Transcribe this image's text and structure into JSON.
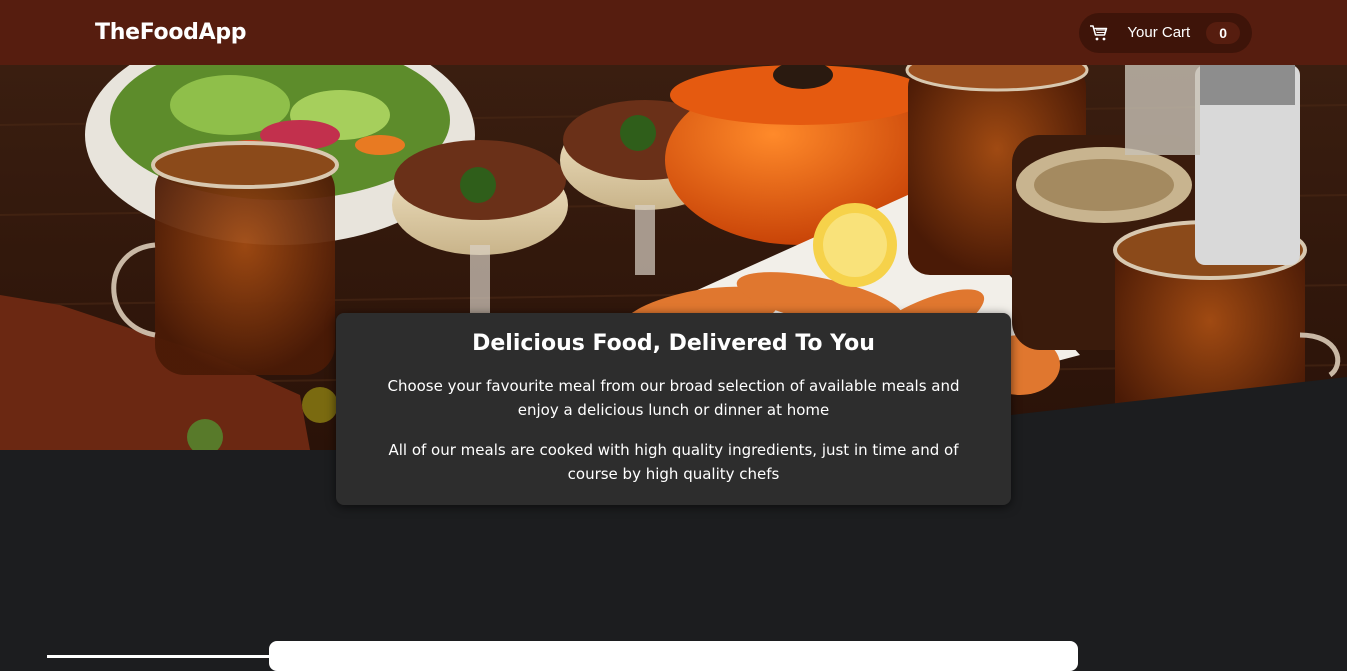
{
  "header": {
    "logo": "TheFoodApp",
    "cart": {
      "label": "Your Cart",
      "count": "0"
    }
  },
  "hero": {
    "image": "table-of-food-image"
  },
  "summary": {
    "title": "Delicious Food, Delivered To You",
    "paragraph1": "Choose your favourite meal from our broad selection of available meals and enjoy a delicious lunch or dinner at home",
    "paragraph2": "All of our meals are cooked with high quality ingredients, just in time and of course by high quality chefs"
  },
  "colors": {
    "header_bg": "#561d0f",
    "cart_bg": "#3e1409",
    "page_bg": "#1c1d1f",
    "summary_bg": "#2d2d2d"
  }
}
